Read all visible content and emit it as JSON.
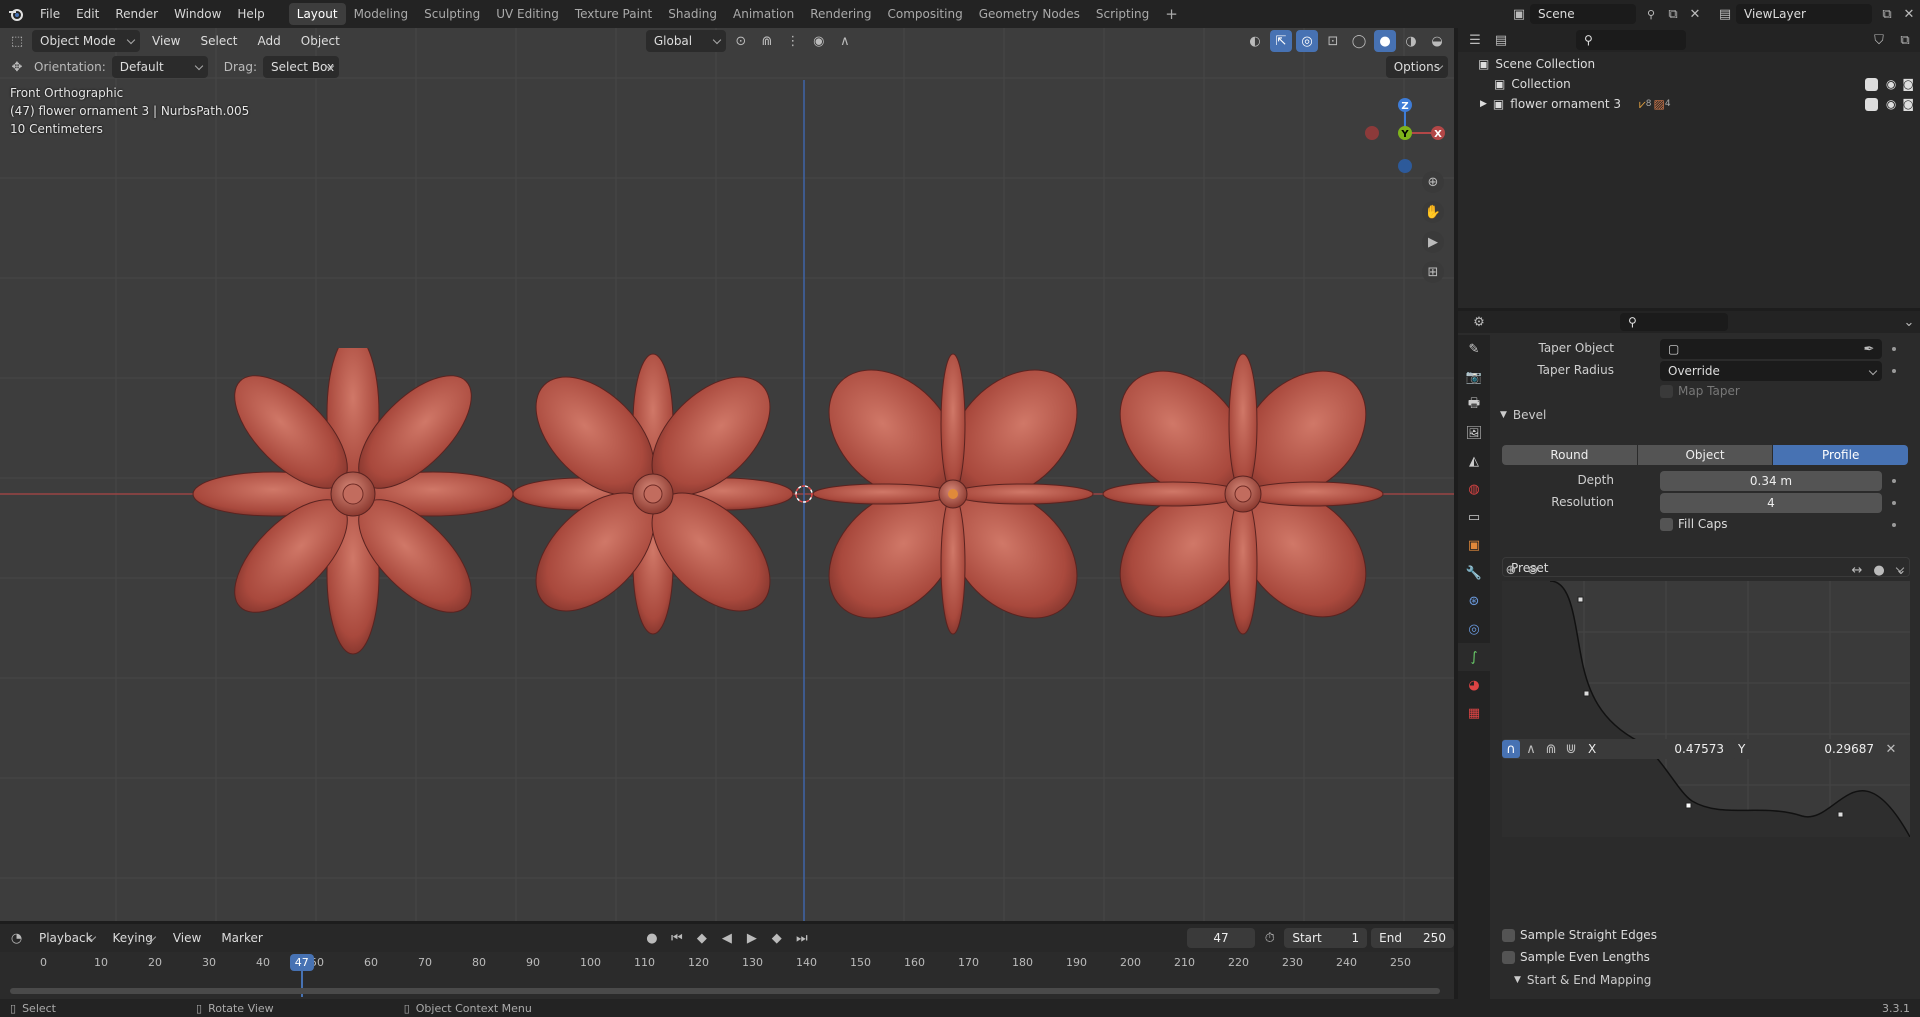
{
  "app": {
    "version": "3.3.1"
  },
  "menu": [
    "File",
    "Edit",
    "Render",
    "Window",
    "Help"
  ],
  "workspaces": [
    "Layout",
    "Modeling",
    "Sculpting",
    "UV Editing",
    "Texture Paint",
    "Shading",
    "Animation",
    "Rendering",
    "Compositing",
    "Geometry Nodes",
    "Scripting"
  ],
  "active_workspace": "Layout",
  "scene": "Scene",
  "view_layer": "ViewLayer",
  "viewport": {
    "mode": "Object Mode",
    "menus": [
      "View",
      "Select",
      "Add",
      "Object"
    ],
    "transform_orientation": "Global",
    "options_label": "Options",
    "orientation_label": "Orientation:",
    "orientation_value": "Default",
    "drag_label": "Drag:",
    "drag_value": "Select Box",
    "overlay": {
      "view_name": "Front Orthographic",
      "object_info": "(47) flower ornament 3 | NurbsPath.005",
      "grid_scale": "10 Centimeters"
    },
    "gizmo": {
      "x": "X",
      "y": "Y",
      "z": "Z"
    }
  },
  "timeline": {
    "menus": [
      "Playback",
      "Keying",
      "View",
      "Marker"
    ],
    "current_frame": "47",
    "start_label": "Start",
    "start": "1",
    "end_label": "End",
    "end": "250",
    "ruler": [
      "0",
      "10",
      "20",
      "30",
      "40",
      "50",
      "60",
      "70",
      "80",
      "90",
      "100",
      "110",
      "120",
      "130",
      "140",
      "150",
      "160",
      "170",
      "180",
      "190",
      "200",
      "210",
      "220",
      "230",
      "240",
      "250"
    ]
  },
  "statusbar": {
    "select": "Select",
    "rotate": "Rotate View",
    "context": "Object Context Menu",
    "version": "3.3.1"
  },
  "outliner": {
    "root": "Scene Collection",
    "items": [
      {
        "label": "Collection"
      },
      {
        "label": "flower ornament 3",
        "badge_a": "8",
        "badge_b": "4"
      }
    ]
  },
  "properties": {
    "taper_object_label": "Taper Object",
    "taper_radius_label": "Taper Radius",
    "taper_radius_value": "Override",
    "map_taper_label": "Map Taper",
    "bevel_header": "Bevel",
    "bevel_modes": [
      "Round",
      "Object",
      "Profile"
    ],
    "active_bevel_mode": "Profile",
    "depth_label": "Depth",
    "depth": "0.34 m",
    "resolution_label": "Resolution",
    "resolution": "4",
    "fill_caps_label": "Fill Caps",
    "preset_label": "Preset",
    "x_label": "X",
    "x_value": "0.47573",
    "y_label": "Y",
    "y_value": "0.29687",
    "sample_straight_label": "Sample Straight Edges",
    "sample_even_label": "Sample Even Lengths",
    "mapping_header": "Start & End Mapping"
  },
  "colors": {
    "accent": "#4772b3",
    "flower": "#b55a4e",
    "grid_bg": "#3d3d3d",
    "x_axis": "#b34747",
    "y_axis": "#7fb31b",
    "z_axis": "#3e7cd6"
  }
}
